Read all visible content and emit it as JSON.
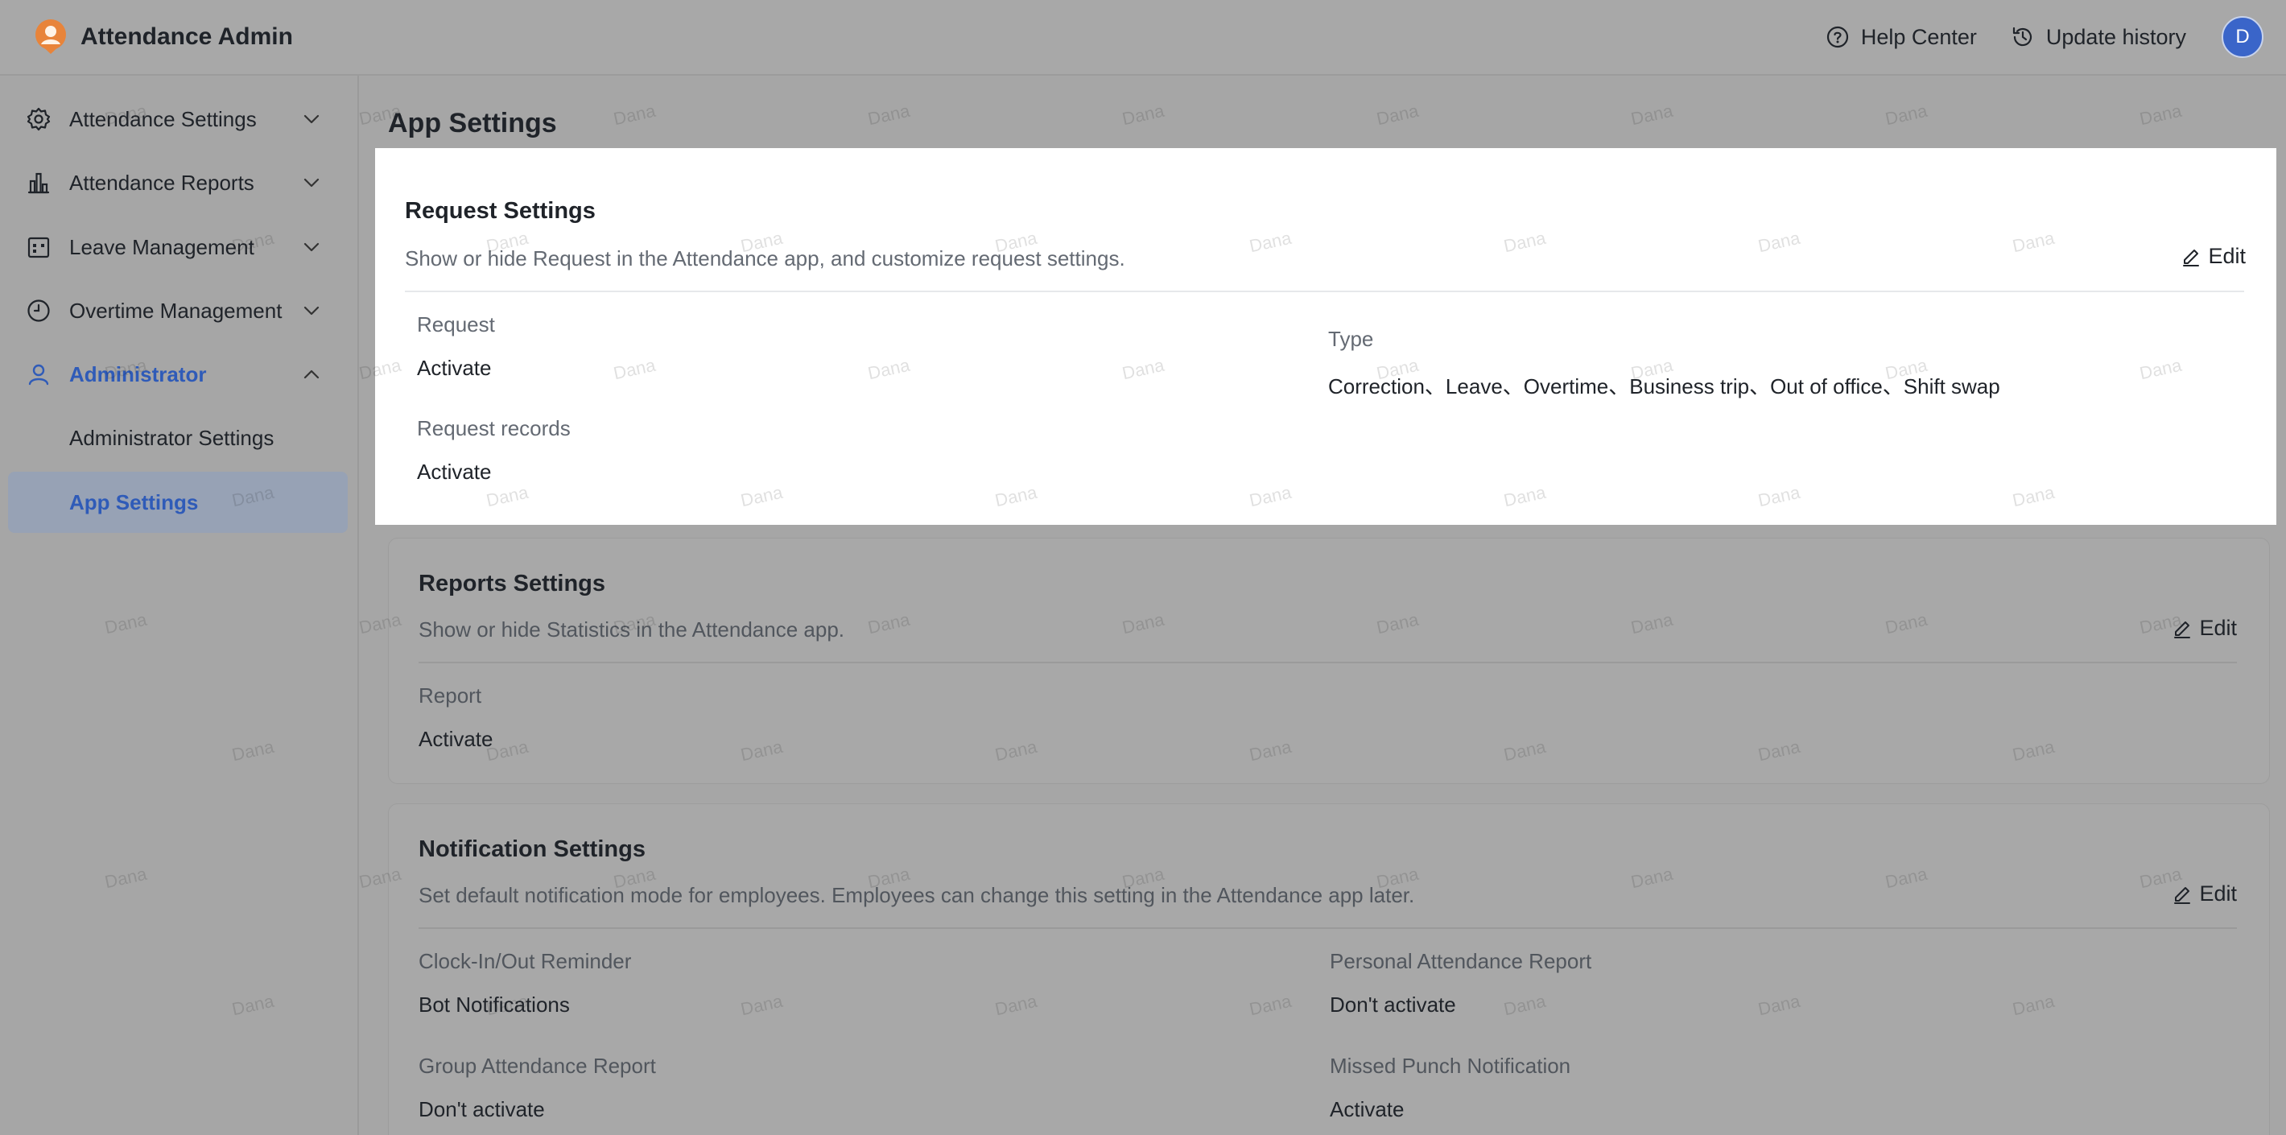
{
  "app": {
    "title": "Attendance Admin",
    "help_center": "Help Center",
    "update_history": "Update history",
    "avatar_initial": "D"
  },
  "sidebar": {
    "items": [
      {
        "label": "Attendance Settings",
        "icon": "gear-icon",
        "expanded": false
      },
      {
        "label": "Attendance Reports",
        "icon": "bar-chart-icon",
        "expanded": false
      },
      {
        "label": "Leave Management",
        "icon": "calendar-icon",
        "expanded": false
      },
      {
        "label": "Overtime Management",
        "icon": "clock-icon",
        "expanded": false
      },
      {
        "label": "Administrator",
        "icon": "user-icon",
        "expanded": true
      }
    ],
    "sub_items": [
      {
        "label": "Administrator Settings",
        "selected": false
      },
      {
        "label": "App Settings",
        "selected": true
      }
    ]
  },
  "main": {
    "page_title": "App Settings",
    "edit_label": "Edit",
    "request": {
      "title": "Request Settings",
      "description": "Show or hide Request in the Attendance app, and customize request settings.",
      "fields": [
        {
          "label": "Request",
          "value": "Activate"
        },
        {
          "label": "Request records",
          "value": "Activate"
        },
        {
          "label": "Type",
          "value": "Correction、Leave、Overtime、Business trip、Out of office、Shift swap"
        }
      ]
    },
    "reports": {
      "title": "Reports Settings",
      "description": "Show or hide Statistics in the Attendance app.",
      "fields": [
        {
          "label": "Report",
          "value": "Activate"
        }
      ]
    },
    "notification": {
      "title": "Notification Settings",
      "description": "Set default notification mode for employees. Employees can change this setting in the Attendance app later.",
      "fields": [
        {
          "label": "Clock-In/Out Reminder",
          "value": "Bot Notifications"
        },
        {
          "label": "Personal Attendance Report",
          "value": "Don't activate"
        },
        {
          "label": "Group Attendance Report",
          "value": "Don't activate"
        },
        {
          "label": "Missed Punch Notification",
          "value": "Activate"
        }
      ]
    }
  },
  "watermark": "Dana",
  "colors": {
    "accent": "#2f5bb8",
    "avatar": "#3a65c9",
    "overlay": "#a6a6a6",
    "card_highlight": "#ffffff"
  }
}
